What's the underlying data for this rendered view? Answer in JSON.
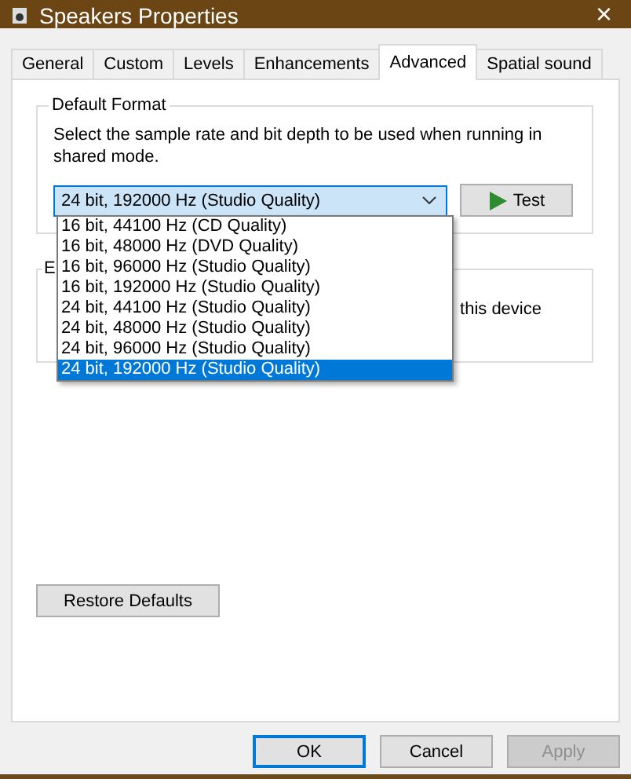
{
  "window": {
    "title": "Speakers Properties",
    "close": "×"
  },
  "tabs": [
    {
      "label": "General",
      "selected": false
    },
    {
      "label": "Custom",
      "selected": false
    },
    {
      "label": "Levels",
      "selected": false
    },
    {
      "label": "Enhancements",
      "selected": false
    },
    {
      "label": "Advanced",
      "selected": true
    },
    {
      "label": "Spatial sound",
      "selected": false
    }
  ],
  "default_format": {
    "legend": "Default Format",
    "description": "Select the sample rate and bit depth to be used when running in shared mode.",
    "value": "24 bit, 192000 Hz (Studio Quality)",
    "expanded": true,
    "options": [
      {
        "label": "16 bit, 44100 Hz (CD Quality)",
        "selected": false
      },
      {
        "label": "16 bit, 48000 Hz (DVD Quality)",
        "selected": false
      },
      {
        "label": "16 bit, 96000 Hz (Studio Quality)",
        "selected": false
      },
      {
        "label": "16 bit, 192000 Hz (Studio Quality)",
        "selected": false
      },
      {
        "label": "24 bit, 44100 Hz (Studio Quality)",
        "selected": false
      },
      {
        "label": "24 bit, 48000 Hz (Studio Quality)",
        "selected": false
      },
      {
        "label": "24 bit, 96000 Hz (Studio Quality)",
        "selected": false
      },
      {
        "label": "24 bit, 192000 Hz (Studio Quality)",
        "selected": true
      }
    ],
    "test_button": "Test"
  },
  "exclusive_group": {
    "legend": "E",
    "text": "this device"
  },
  "restore_button": "Restore Defaults",
  "buttons": [
    {
      "label": "OK",
      "default": true,
      "disabled": false
    },
    {
      "label": "Cancel",
      "default": false,
      "disabled": false
    },
    {
      "label": "Apply",
      "default": false,
      "disabled": true
    }
  ]
}
